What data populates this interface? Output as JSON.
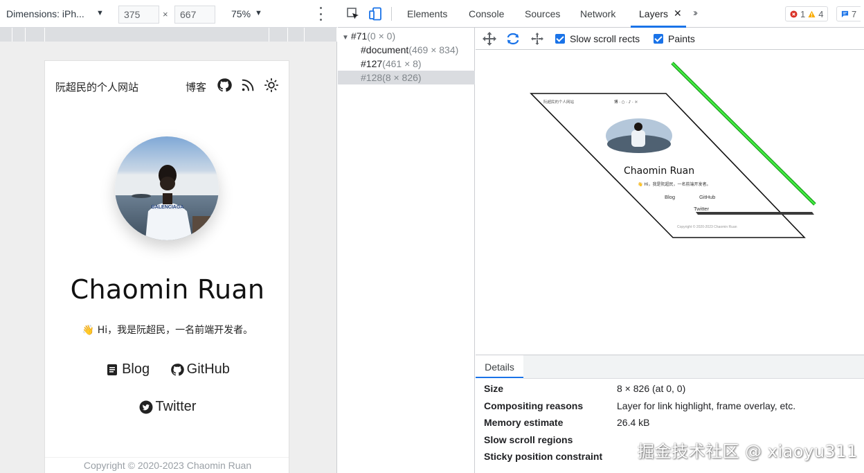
{
  "device_toolbar": {
    "dimensions_label": "Dimensions: iPh...",
    "width_value": "375",
    "times": "×",
    "height_value": "667",
    "zoom": "75%",
    "more_icon": "kebab-vertical-icon"
  },
  "site": {
    "title": "阮超民的个人网站",
    "nav_blog": "博客",
    "nav_icons": [
      "github-icon",
      "rss-icon",
      "sun-icon"
    ],
    "name": "Chaomin Ruan",
    "greeting": "👋 Hi，我是阮超民，一名前端开发者。",
    "links": {
      "blog": "Blog",
      "github": "GitHub",
      "twitter": "Twitter"
    },
    "copyright": "Copyright © 2020-2023 Chaomin Ruan"
  },
  "devtools": {
    "tabs": [
      "Elements",
      "Console",
      "Sources",
      "Network",
      "Layers"
    ],
    "active_tab": "Layers",
    "accent": "#1a73e8",
    "badges": {
      "errors": "1",
      "warnings": "4",
      "messages": "7"
    }
  },
  "layer_tree": {
    "rows": [
      {
        "name": "#71",
        "size": "(0 × 0)"
      },
      {
        "name": "#document",
        "size": "(469 × 834)"
      },
      {
        "name": "#127",
        "size": "(461 × 8)"
      },
      {
        "name": "#128",
        "size": "(8 × 826)"
      }
    ]
  },
  "viewport_toolbar": {
    "icons": [
      "pan-icon",
      "rotate-icon",
      "reset-transform-icon"
    ],
    "slow_scroll_rects": "Slow scroll rects",
    "paints": "Paints"
  },
  "thumbnail": {
    "title": "阮超民的个人网站",
    "name": "Chaomin Ruan",
    "greeting": "👋 Hi，我是阮超民，一名前端开发者。",
    "blog": "Blog",
    "github": "GitHub",
    "twitter": "Twitter",
    "copyright": "Copyright © 2020-2023 Chaomin Ruan",
    "layer_highlight_color": "#22dd22"
  },
  "details": {
    "tab": "Details",
    "rows": [
      {
        "key": "Size",
        "value": "8 × 826 (at 0, 0)"
      },
      {
        "key": "Compositing reasons",
        "value": "Layer for link highlight, frame overlay, etc."
      },
      {
        "key": "Memory estimate",
        "value": "26.4 kB"
      },
      {
        "key": "Slow scroll regions",
        "value": ""
      },
      {
        "key": "Sticky position constraint",
        "value": ""
      }
    ]
  },
  "watermark": "掘金技术社区 @ xiaoyu311"
}
